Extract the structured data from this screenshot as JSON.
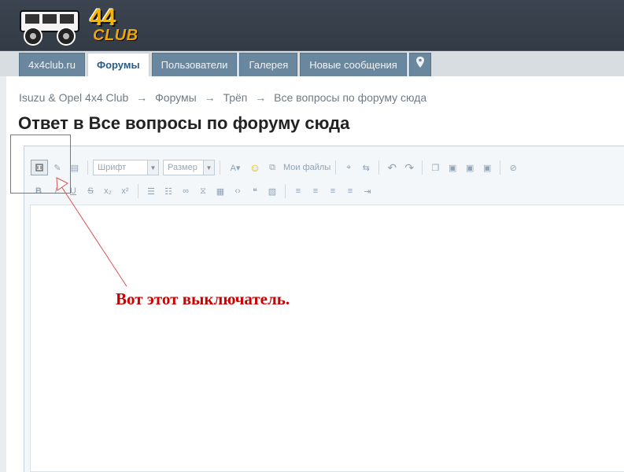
{
  "logo": {
    "name": "4x4 club logo",
    "text_44": "44",
    "text_club": "CLUB"
  },
  "nav": {
    "tabs": [
      {
        "label": "4x4club.ru",
        "active": false
      },
      {
        "label": "Форумы",
        "active": true
      },
      {
        "label": "Пользователи",
        "active": false
      },
      {
        "label": "Галерея",
        "active": false
      },
      {
        "label": "Новые сообщения",
        "active": false
      }
    ],
    "pin_icon": "map-pin-icon"
  },
  "breadcrumb": {
    "items": [
      "Isuzu & Opel 4x4 Club",
      "Форумы",
      "Трёп",
      "Все вопросы по форуму сюда"
    ],
    "separator": "→"
  },
  "page_title": "Ответ в Все вопросы по форуму сюда",
  "editor": {
    "toolbar": {
      "font_select": "Шрифт",
      "size_select": "Размер",
      "my_files": "Мои файлы",
      "source_toggle_icon": "source-mode-toggle-icon"
    },
    "body_text": ""
  },
  "annotation": {
    "text": "Вот этот выключатель.",
    "color": "#cc0000"
  },
  "colors": {
    "header_bg": "#343c46",
    "tab_bg": "#6a87a0",
    "active_tab_text": "#2c5b84",
    "annotation_red": "#cc0000"
  }
}
